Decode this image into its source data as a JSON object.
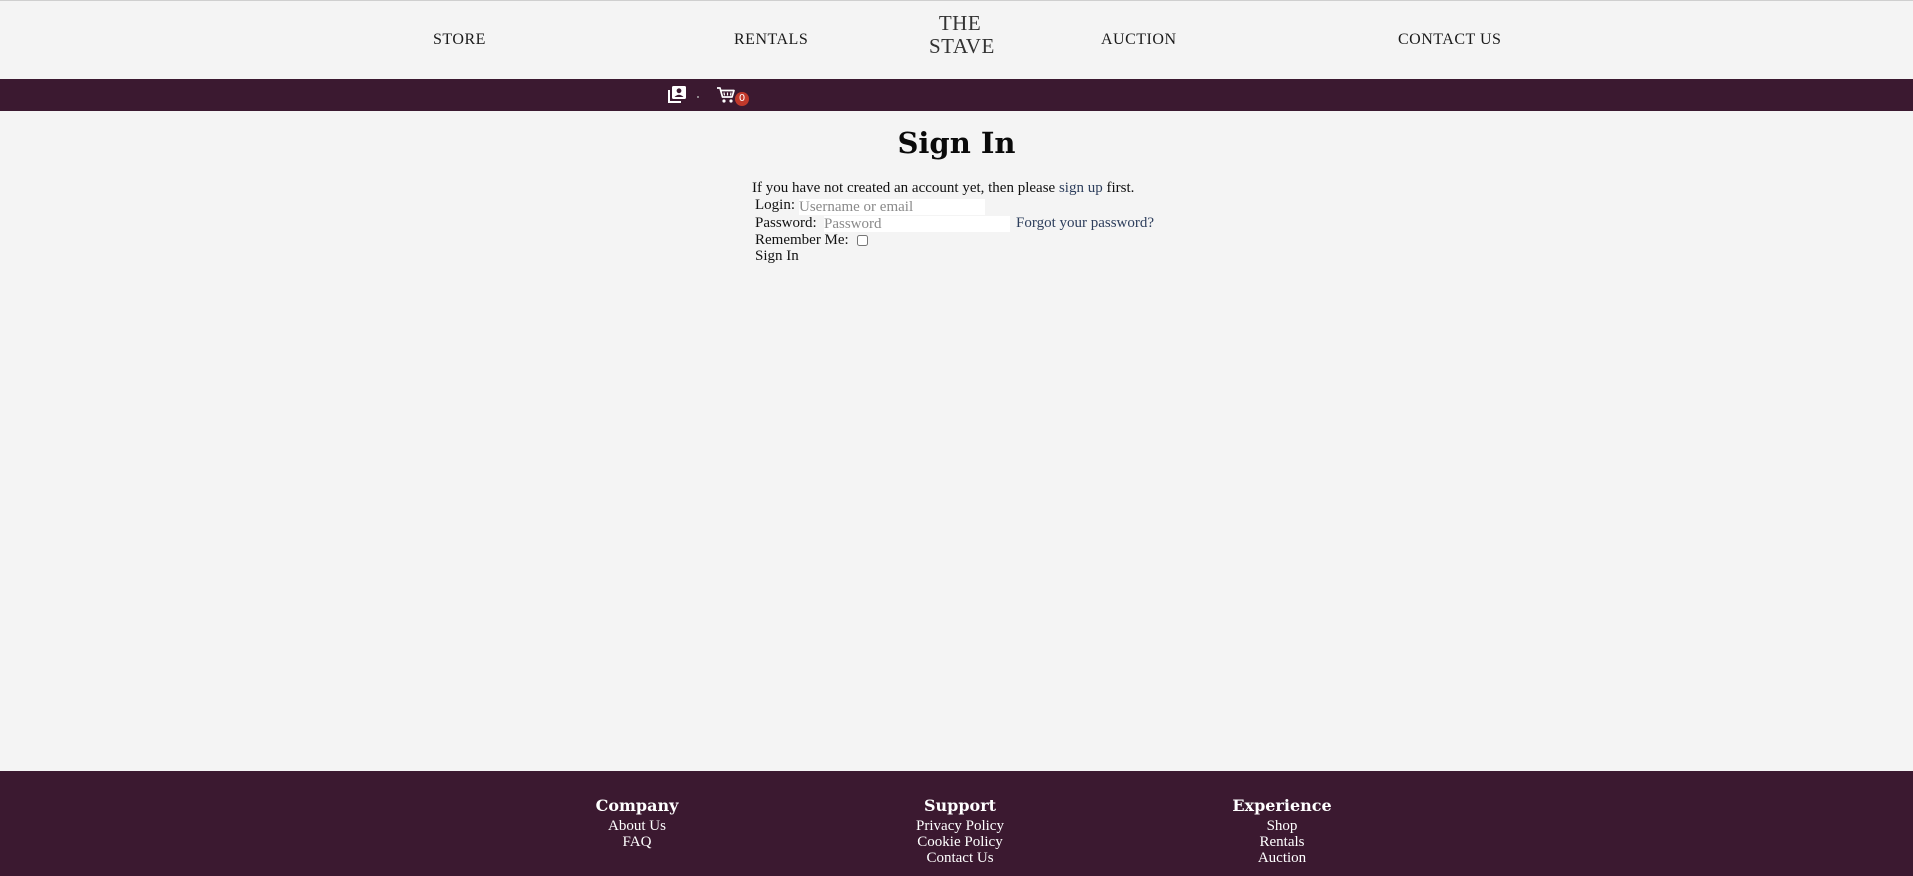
{
  "nav": {
    "store": "STORE",
    "rentals": "RENTALS",
    "brand_line1": "THE",
    "brand_line2": "STAVE",
    "auction": "AUCTION",
    "contact": "CONTACT US"
  },
  "subbar": {
    "account_icon": "account-box-icon",
    "cart_icon": "cart-icon",
    "cart_count": "0"
  },
  "signin": {
    "title": "Sign In",
    "intro_prefix": "If you have not created an account yet, then please",
    "signup_link": "sign up",
    "intro_suffix": "first.",
    "login_label": "Login:",
    "login_placeholder": "Username or email",
    "password_label": "Password:",
    "password_placeholder": "Password",
    "forgot_link": "Forgot your password?",
    "remember_label": "Remember Me:",
    "submit_label": "Sign In"
  },
  "footer": {
    "company": {
      "heading": "Company",
      "links": [
        "About Us",
        "FAQ"
      ]
    },
    "support": {
      "heading": "Support",
      "links": [
        "Privacy Policy",
        "Cookie Policy",
        "Contact Us"
      ]
    },
    "experience": {
      "heading": "Experience",
      "links": [
        "Shop",
        "Rentals",
        "Auction"
      ]
    }
  },
  "colors": {
    "page_bg": "#f4f4f4",
    "bar_bg": "#3b1930",
    "link": "#2d3e5c",
    "badge": "#c0392b"
  }
}
